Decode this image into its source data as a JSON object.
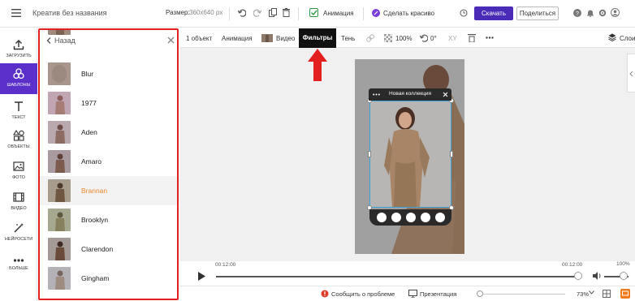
{
  "header": {
    "title": "Креатив без названия",
    "size_label": "Размер:",
    "size_value": "360x640 px",
    "animation_label": "Анимация",
    "pretty_label": "Сделать красиво",
    "download_label": "Скачать",
    "share_label": "Поделиться"
  },
  "leftnav": {
    "items": [
      {
        "label": "Загрузить",
        "icon": "upload-icon"
      },
      {
        "label": "Шаблоны",
        "icon": "templates-icon",
        "active": true
      },
      {
        "label": "Текст",
        "icon": "text-icon"
      },
      {
        "label": "Объекты",
        "icon": "objects-icon"
      },
      {
        "label": "Фото",
        "icon": "photo-icon"
      },
      {
        "label": "Видео",
        "icon": "video-icon"
      },
      {
        "label": "Нейросети",
        "icon": "ai-wand-icon"
      },
      {
        "label": "Больше",
        "icon": "more-icon"
      }
    ]
  },
  "panel": {
    "back_label": "Назад",
    "filters": [
      {
        "name": "Blur"
      },
      {
        "name": "1977"
      },
      {
        "name": "Aden"
      },
      {
        "name": "Amaro"
      },
      {
        "name": "Brannan",
        "selected": true
      },
      {
        "name": "Brooklyn"
      },
      {
        "name": "Clarendon"
      },
      {
        "name": "Gingham"
      }
    ]
  },
  "toolbar": {
    "objects": "1 объект",
    "animation": "Анимация",
    "video": "Видео",
    "filters": "Фильтры",
    "shadow": "Тень",
    "opacity": "100%",
    "rotation": "0°",
    "xy": "XY",
    "layers": "Слои"
  },
  "canvas": {
    "popup_title": "Новая коллекция"
  },
  "timeline": {
    "start_time": "00:12:00",
    "end_time": "00:12:00",
    "volume": "100%"
  },
  "statusbar": {
    "report": "Сообщить о проблеме",
    "presentation": "Презентация",
    "zoom": "73%"
  },
  "colors": {
    "accent": "#5b2fc9",
    "download": "#4a2bb8",
    "highlight_border": "#e32020",
    "selected_filter": "#e8892c"
  }
}
